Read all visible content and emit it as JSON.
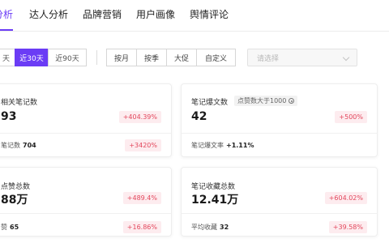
{
  "nav": {
    "tabs": [
      {
        "label": "分析",
        "active": true
      },
      {
        "label": "达人分析"
      },
      {
        "label": "品牌营销"
      },
      {
        "label": "用户画像"
      },
      {
        "label": "舆情评论"
      }
    ]
  },
  "filters": {
    "ranges": [
      {
        "label": "天"
      },
      {
        "label": "近30天",
        "active": true
      },
      {
        "label": "近90天"
      }
    ],
    "periods": [
      "按月",
      "按季",
      "大促",
      "自定义"
    ],
    "select": {
      "placeholder": "请选择"
    }
  },
  "colors": {
    "accent": "#6b3cf5",
    "badge_text": "#e3475c",
    "badge_bg": "#fdecef"
  },
  "cards": [
    {
      "title": "相关笔记数",
      "value": "93",
      "change": "+404.39%",
      "sub_label": "笔记数",
      "sub_value": "704",
      "sub_change": "+3420%"
    },
    {
      "title": "笔记爆文数",
      "tag": "点赞数大于1000",
      "tag_icon": "gear-icon",
      "value": "42",
      "change": "+500%",
      "sub_label": "笔记爆文率",
      "sub_value": "+1.11%"
    },
    {
      "title": "点赞总数",
      "value": "88万",
      "change": "+489.4%",
      "sub_label": "赞",
      "sub_value": "65",
      "sub_change": "+16.86%"
    },
    {
      "title": "笔记收藏总数",
      "value": "12.41万",
      "change": "+604.02%",
      "sub_label": "平均收藏",
      "sub_value": "32",
      "sub_change": "+39.58%"
    }
  ]
}
